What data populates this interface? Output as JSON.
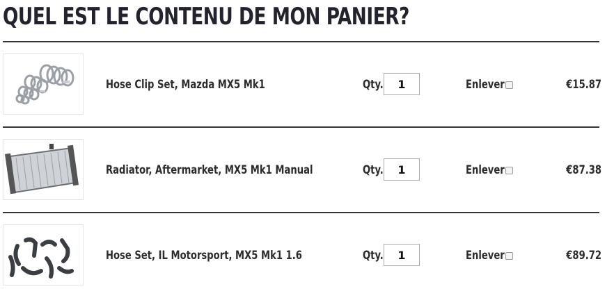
{
  "page": {
    "title": "QUEL EST LE CONTENU DE MON PANIER?"
  },
  "cart": {
    "qty_label": "Qty.",
    "remove_label": "Enlever",
    "items": [
      {
        "name": "Hose Clip Set, Mazda MX5 Mk1",
        "qty": "1",
        "price": "€15.87",
        "image_icon": "hose-clip-set-photo"
      },
      {
        "name": "Radiator, Aftermarket, MX5 Mk1 Manual",
        "qty": "1",
        "price": "€87.38",
        "image_icon": "radiator-photo"
      },
      {
        "name": "Hose Set, IL Motorsport, MX5 Mk1 1.6",
        "qty": "1",
        "price": "€89.72",
        "image_icon": "hose-set-photo"
      }
    ]
  },
  "colors": {
    "text": "#2c2c2c",
    "title": "#23232d",
    "rule": "#333333"
  }
}
